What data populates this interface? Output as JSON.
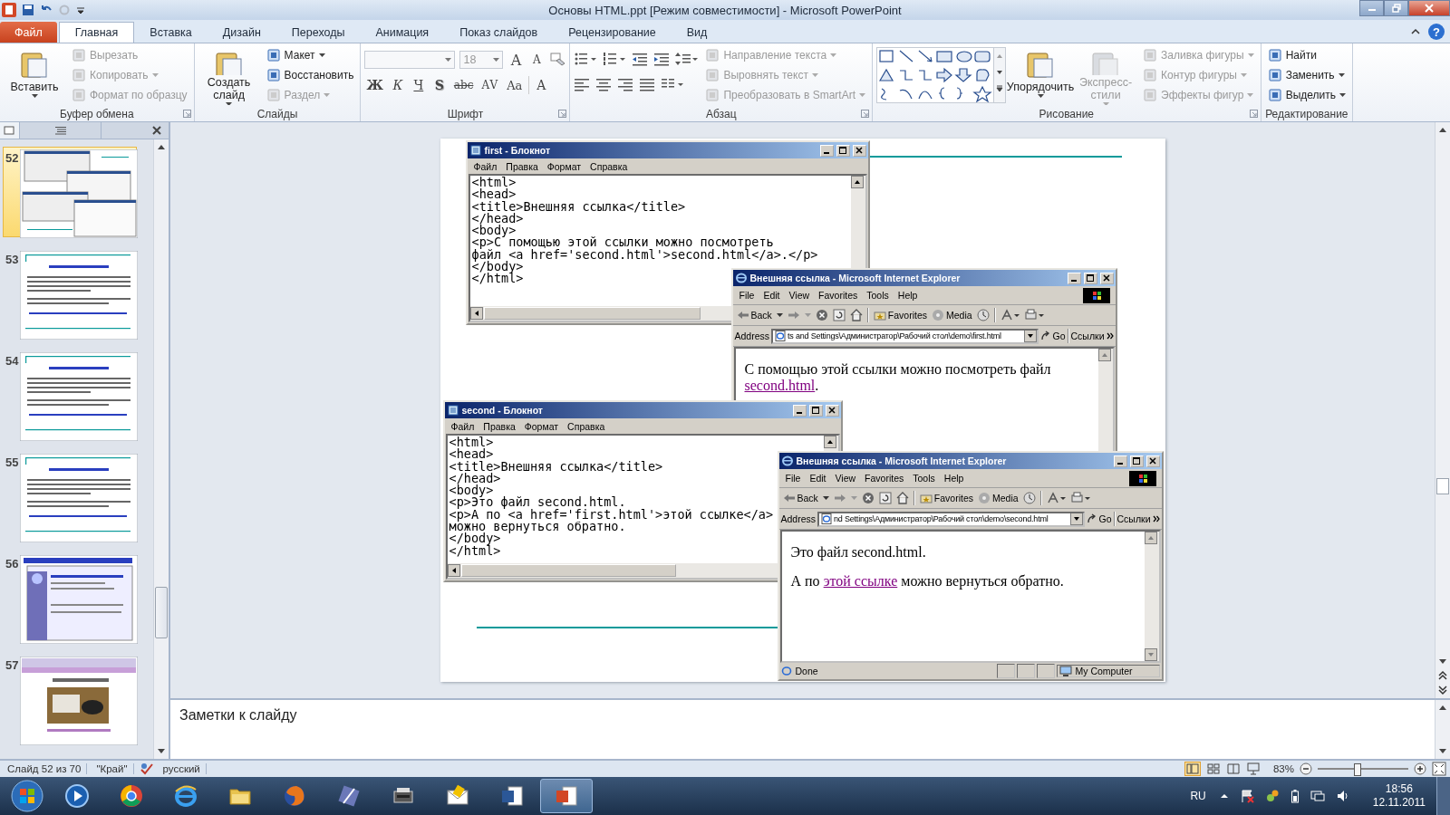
{
  "window": {
    "title": "Основы HTML.ppt [Режим совместимости]  -  Microsoft PowerPoint"
  },
  "ribbon": {
    "tabs": [
      {
        "label": "Файл",
        "kind": "file",
        "selected": false
      },
      {
        "label": "Главная",
        "kind": "tab",
        "selected": true
      },
      {
        "label": "Вставка",
        "kind": "tab",
        "selected": false
      },
      {
        "label": "Дизайн",
        "kind": "tab",
        "selected": false
      },
      {
        "label": "Переходы",
        "kind": "tab",
        "selected": false
      },
      {
        "label": "Анимация",
        "kind": "tab",
        "selected": false
      },
      {
        "label": "Показ слайдов",
        "kind": "tab",
        "selected": false
      },
      {
        "label": "Рецензирование",
        "kind": "tab",
        "selected": false
      },
      {
        "label": "Вид",
        "kind": "tab",
        "selected": false
      }
    ],
    "help": "?",
    "groups": [
      {
        "kind": "buttons",
        "label": "Буфер обмена",
        "launcher": true,
        "columns": [
          [
            {
              "kind": "large",
              "label": "Вставить",
              "disabled": false,
              "dropdown": true
            }
          ],
          [
            {
              "kind": "small",
              "label": "Вырезать",
              "disabled": true,
              "dropdown": false
            },
            {
              "kind": "small",
              "label": "Копировать",
              "disabled": true,
              "dropdown": true
            },
            {
              "kind": "small",
              "label": "Формат по образцу",
              "disabled": true,
              "dropdown": false
            }
          ]
        ]
      },
      {
        "kind": "buttons",
        "label": "Слайды",
        "launcher": false,
        "columns": [
          [
            {
              "kind": "large",
              "label": "Создать слайд",
              "disabled": false,
              "dropdown": true
            }
          ],
          [
            {
              "kind": "small",
              "label": "Макет",
              "disabled": false,
              "dropdown": true
            },
            {
              "kind": "small",
              "label": "Восстановить",
              "disabled": false,
              "dropdown": false
            },
            {
              "kind": "small",
              "label": "Раздел",
              "disabled": true,
              "dropdown": true
            }
          ]
        ]
      },
      {
        "kind": "font",
        "label": "Шрифт",
        "launcher": true,
        "font_size": "18",
        "row1": [
          {
            "label": "A"
          },
          {
            "label": "A"
          }
        ],
        "row2": [
          {
            "label": "Ж"
          },
          {
            "label": "К"
          },
          {
            "label": "Ч"
          },
          {
            "label": "S"
          },
          {
            "label": "abc"
          },
          {
            "label": "AV"
          },
          {
            "label": "Aa"
          },
          {
            "label": "A"
          }
        ]
      },
      {
        "kind": "paragraph",
        "label": "Абзац",
        "launcher": true,
        "columns": [
          [
            {
              "kind": "small",
              "label": "Направление текста",
              "disabled": true,
              "dropdown": true
            },
            {
              "kind": "small",
              "label": "Выровнять текст",
              "disabled": true,
              "dropdown": true
            },
            {
              "kind": "small",
              "label": "Преобразовать в SmartArt",
              "disabled": true,
              "dropdown": true
            }
          ]
        ]
      },
      {
        "kind": "drawing",
        "label": "Рисование",
        "launcher": true,
        "columns": [
          [
            {
              "kind": "large",
              "label": "Упорядочить",
              "disabled": false,
              "dropdown": true
            }
          ],
          [
            {
              "kind": "large",
              "label": "Экспресс-стили",
              "disabled": true,
              "dropdown": true
            }
          ],
          [
            {
              "kind": "small",
              "label": "Заливка фигуры",
              "disabled": true,
              "dropdown": true
            },
            {
              "kind": "small",
              "label": "Контур фигуры",
              "disabled": true,
              "dropdown": true
            },
            {
              "kind": "small",
              "label": "Эффекты фигур",
              "disabled": true,
              "dropdown": true
            }
          ]
        ]
      },
      {
        "kind": "buttons",
        "label": "Редактирование",
        "launcher": false,
        "columns": [
          [
            {
              "kind": "small",
              "label": "Найти",
              "disabled": false,
              "dropdown": false
            },
            {
              "kind": "small",
              "label": "Заменить",
              "disabled": false,
              "dropdown": true
            },
            {
              "kind": "small",
              "label": "Выделить",
              "disabled": false,
              "dropdown": true
            }
          ]
        ]
      }
    ]
  },
  "slide_panel": {
    "thumbnails": [
      {
        "number": "52",
        "kind": "windows",
        "selected": true
      },
      {
        "number": "53",
        "kind": "text",
        "selected": false
      },
      {
        "number": "54",
        "kind": "text",
        "selected": false
      },
      {
        "number": "55",
        "kind": "text",
        "selected": false
      },
      {
        "number": "56",
        "kind": "screenshot",
        "selected": false
      },
      {
        "number": "57",
        "kind": "photo",
        "selected": false
      }
    ]
  },
  "slide": {
    "windows": [
      {
        "kind": "notepad",
        "title": "first - Блокнот",
        "menu": [
          "Файл",
          "Правка",
          "Формат",
          "Справка"
        ],
        "lines": [
          "<html>",
          "<head>",
          "<title>Внешняя ссылка</title>",
          "</head>",
          "<body>",
          "<p>С помощью этой ссылки можно посмотреть",
          "файл <a href='second.html'>second.html</a>.</p>",
          "</body>",
          "</html>"
        ]
      },
      {
        "kind": "browser",
        "title": "Внешняя ссылка - Microsoft Internet Explorer",
        "menu": [
          "File",
          "Edit",
          "View",
          "Favorites",
          "Tools",
          "Help"
        ],
        "toolbar": {
          "back": "Back",
          "favorites": "Favorites",
          "media": "Media"
        },
        "address_label": "Address",
        "address": "ts and Settings\\Администратор\\Рабочий стол\\demo\\first.html",
        "go": "Go",
        "links": "Ссылки",
        "paragraphs": [
          [
            {
              "text": "С помощью этой ссылки можно посмотреть файл ",
              "link": false
            },
            {
              "text": "second.html",
              "link": true
            },
            {
              "text": ".",
              "link": false
            }
          ]
        ]
      },
      {
        "kind": "notepad",
        "title": "second - Блокнот",
        "menu": [
          "Файл",
          "Правка",
          "Формат",
          "Справка"
        ],
        "lines": [
          "<html>",
          "<head>",
          "<title>Внешняя ссылка</title>",
          "</head>",
          "<body>",
          "<p>Это файл second.html.",
          "<p>А по <a href='first.html'>этой ссылке</a>",
          "можно вернуться обратно.",
          "</body>",
          "</html>"
        ]
      },
      {
        "kind": "browser",
        "title": "Внешняя ссылка - Microsoft Internet Explorer",
        "menu": [
          "File",
          "Edit",
          "View",
          "Favorites",
          "Tools",
          "Help"
        ],
        "toolbar": {
          "back": "Back",
          "favorites": "Favorites",
          "media": "Media"
        },
        "address_label": "Address",
        "address": "nd Settings\\Администратор\\Рабочий стол\\demo\\second.html",
        "go": "Go",
        "links": "Ссылки",
        "paragraphs": [
          [
            {
              "text": "Это файл second.html.",
              "link": false
            }
          ],
          [
            {
              "text": "А по ",
              "link": false
            },
            {
              "text": "этой ссылке",
              "link": true
            },
            {
              "text": " можно вернуться обратно.",
              "link": false
            }
          ]
        ],
        "status": "Done",
        "zone": "My Computer"
      }
    ]
  },
  "notes": {
    "placeholder": "Заметки к слайду"
  },
  "status_bar": {
    "slide": "Слайд 52 из 70",
    "theme": "\"Край\"",
    "language": "русский",
    "zoom": "83%",
    "zoom_slider": {
      "level": 0.43
    }
  },
  "taskbar": {
    "apps": [
      {
        "selected": false
      },
      {
        "selected": false
      },
      {
        "selected": false
      },
      {
        "selected": false
      },
      {
        "selected": false
      },
      {
        "selected": false
      },
      {
        "selected": false
      },
      {
        "selected": false
      },
      {
        "selected": false
      },
      {
        "selected": true
      }
    ],
    "language": "RU",
    "time": "18:56",
    "date": "12.11.2011"
  }
}
